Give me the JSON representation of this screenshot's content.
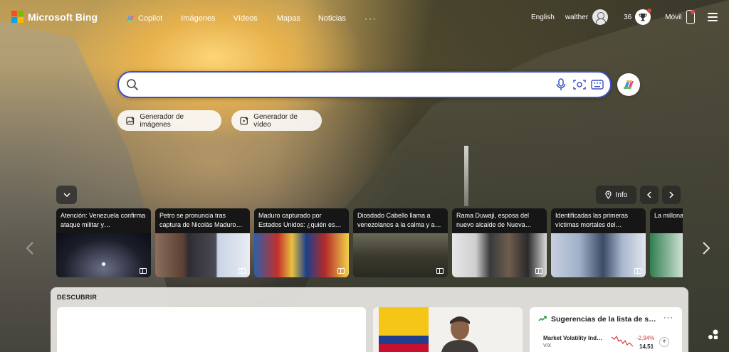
{
  "brand": {
    "name": "Microsoft Bing"
  },
  "nav": {
    "copilot": "Copilot",
    "images": "Imágenes",
    "videos": "Vídeos",
    "maps": "Mapas",
    "news": "Noticias",
    "more": "···"
  },
  "account": {
    "language": "English",
    "username": "walther",
    "points": "36",
    "mobile_label": "Móvil"
  },
  "search": {
    "value": "",
    "placeholder": ""
  },
  "quick_actions": {
    "image_generator": "Generador de imágenes",
    "video_generator": "Generador de vídeo"
  },
  "strip": {
    "info_label": "Info"
  },
  "news_cards": [
    {
      "headline": "Atención: Venezuela confirma ataque militar y…"
    },
    {
      "headline": "Petro se pronuncia tras captura de Nicolás Maduro…"
    },
    {
      "headline": "Maduro capturado por Estados Unidos: ¿quién es…"
    },
    {
      "headline": "Diosdado Cabello llama a venezolanos a la calma y a…"
    },
    {
      "headline": "Rama Duwaji, esposa del nuevo alcalde de Nueva…"
    },
    {
      "headline": "Identificadas las primeras víctimas mortales del…"
    },
    {
      "headline": "La millonac Once Calda"
    }
  ],
  "discover": {
    "title": "DESCUBRIR",
    "watchlist": {
      "title": "Sugerencias de la lista de s…",
      "more": "···",
      "stock_name": "Market Volatility Ind…",
      "stock_symbol": "VIX",
      "change": "-2,94%",
      "value": "14,51",
      "add": "+"
    }
  },
  "colors": {
    "accent": "#3b50c8",
    "logo_red": "#f25022",
    "logo_green": "#7fba00",
    "logo_blue": "#00a4ef",
    "logo_yellow": "#ffb900",
    "negative": "#d13438"
  },
  "icons": [
    "copilot-icon",
    "search-icon",
    "microphone-icon",
    "visual-search-icon",
    "keyboard-icon",
    "avatar-icon",
    "trophy-icon",
    "mobile-icon",
    "menu-icon",
    "chevron-down-icon",
    "location-icon",
    "chevron-left-icon",
    "chevron-right-icon",
    "reader-icon",
    "trending-icon"
  ]
}
